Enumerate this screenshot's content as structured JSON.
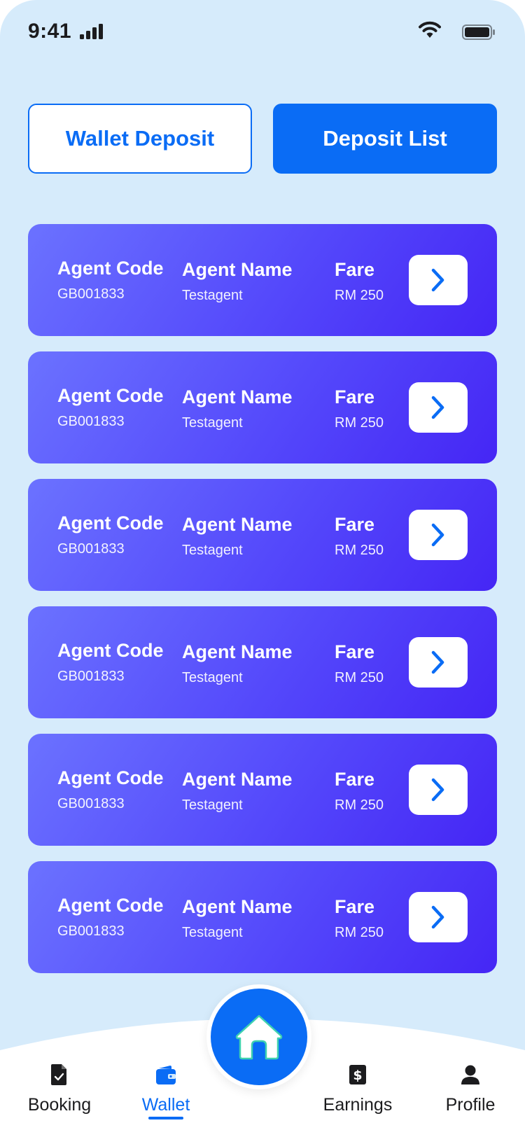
{
  "status_bar": {
    "time": "9:41"
  },
  "tabs": {
    "wallet_deposit": "Wallet Deposit",
    "deposit_list": "Deposit List"
  },
  "cards": [
    {
      "code_label": "Agent Code",
      "code": "GB001833",
      "name_label": "Agent Name",
      "name": "Testagent",
      "fare_label": "Fare",
      "fare": "RM 250"
    },
    {
      "code_label": "Agent Code",
      "code": "GB001833",
      "name_label": "Agent Name",
      "name": "Testagent",
      "fare_label": "Fare",
      "fare": "RM 250"
    },
    {
      "code_label": "Agent Code",
      "code": "GB001833",
      "name_label": "Agent Name",
      "name": "Testagent",
      "fare_label": "Fare",
      "fare": "RM 250"
    },
    {
      "code_label": "Agent Code",
      "code": "GB001833",
      "name_label": "Agent Name",
      "name": "Testagent",
      "fare_label": "Fare",
      "fare": "RM 250"
    },
    {
      "code_label": "Agent Code",
      "code": "GB001833",
      "name_label": "Agent Name",
      "name": "Testagent",
      "fare_label": "Fare",
      "fare": "RM 250"
    },
    {
      "code_label": "Agent Code",
      "code": "GB001833",
      "name_label": "Agent Name",
      "name": "Testagent",
      "fare_label": "Fare",
      "fare": "RM 250"
    }
  ],
  "bottom_nav": {
    "items": [
      {
        "label": "Booking",
        "icon": "booking-icon"
      },
      {
        "label": "Wallet",
        "icon": "wallet-icon",
        "active": true
      },
      {
        "label": "Earnings",
        "icon": "earnings-icon"
      },
      {
        "label": "Profile",
        "icon": "profile-icon"
      }
    ],
    "center_icon": "home-icon"
  },
  "colors": {
    "background": "#d6ebfb",
    "accent": "#0a6cf5",
    "card_gradient_start": "#6b72ff",
    "card_gradient_end": "#4526f5"
  }
}
